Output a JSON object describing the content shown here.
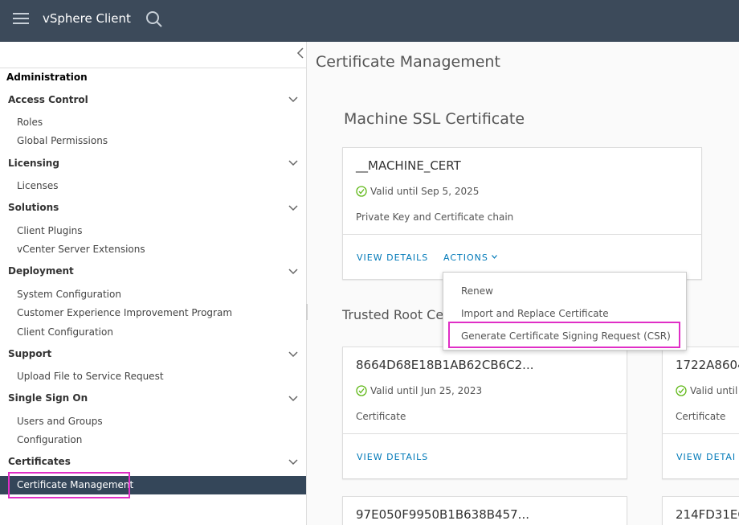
{
  "header": {
    "app_title": "vSphere Client"
  },
  "sidebar": {
    "heading": "Administration",
    "sections": {
      "access_control": {
        "label": "Access Control",
        "items": [
          "Roles",
          "Global Permissions"
        ]
      },
      "licensing": {
        "label": "Licensing",
        "items": [
          "Licenses"
        ]
      },
      "solutions": {
        "label": "Solutions",
        "items": [
          "Client Plugins",
          "vCenter Server Extensions"
        ]
      },
      "deployment": {
        "label": "Deployment",
        "items": [
          "System Configuration",
          "Customer Experience Improvement Program",
          "Client Configuration"
        ]
      },
      "support": {
        "label": "Support",
        "items": [
          "Upload File to Service Request"
        ]
      },
      "sso": {
        "label": "Single Sign On",
        "items": [
          "Users and Groups",
          "Configuration"
        ]
      },
      "certificates": {
        "label": "Certificates",
        "items": [
          "Certificate Management"
        ]
      }
    },
    "active_item": "Certificate Management"
  },
  "main": {
    "page_title": "Certificate Management",
    "machine_ssl": {
      "section_title": "Machine SSL Certificate",
      "card": {
        "name": "__MACHINE_CERT",
        "valid": "Valid until Sep 5, 2025",
        "desc": "Private Key and Certificate chain",
        "view_details": "VIEW DETAILS",
        "actions": "ACTIONS"
      }
    },
    "actions_menu": [
      "Renew",
      "Import and Replace Certificate",
      "Generate Certificate Signing Request (CSR)"
    ],
    "trusted_root": {
      "section_title": "Trusted Root Ce",
      "cards": [
        {
          "name": "8664D68E18B1AB62CB6C2...",
          "valid": "Valid until Jun 25, 2023",
          "desc": "Certificate",
          "view_details": "VIEW DETAILS"
        },
        {
          "name": "1722A8604",
          "valid": "Valid until",
          "desc": "Certificate",
          "view_details": "VIEW DETAI"
        },
        {
          "name": "97E050F9950B1B638B457..."
        },
        {
          "name": "214FD31EC"
        }
      ]
    }
  },
  "colors": {
    "header_bg": "#3c4a5a",
    "active_bg": "#344659",
    "link": "#0079b8",
    "highlight": "#e02ec6",
    "valid_green": "#5eb715"
  }
}
